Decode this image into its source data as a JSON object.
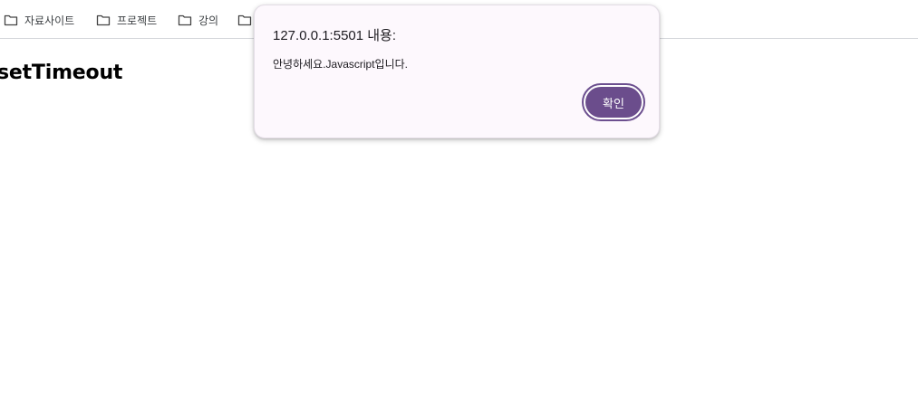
{
  "bookmarks": [
    {
      "label": "자료사이트",
      "icon": "folder-icon"
    },
    {
      "label": "프로젝트",
      "icon": "folder-icon"
    },
    {
      "label": "강의",
      "icon": "folder-icon"
    },
    {
      "label": "",
      "icon": "folder-icon"
    }
  ],
  "page": {
    "heading": "setTimeout"
  },
  "alert": {
    "origin": "127.0.0.1:5501 내용:",
    "message": "안녕하세요.Javascript입니다.",
    "ok_label": "확인",
    "accent_color": "#6b4d8c"
  }
}
